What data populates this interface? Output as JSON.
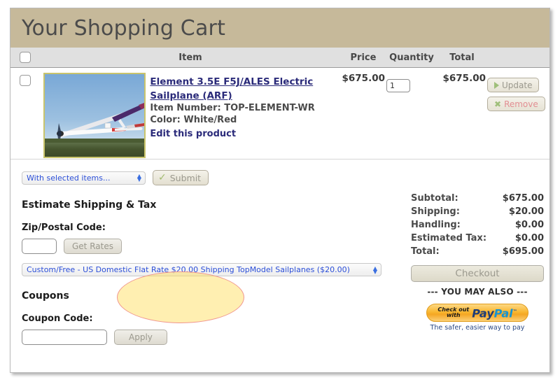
{
  "cart": {
    "title": "Your Shopping Cart",
    "columns": {
      "item": "Item",
      "price": "Price",
      "quantity": "Quantity",
      "total": "Total"
    },
    "rows": [
      {
        "title": "Element 3.5E F5J/ALES Electric Sailplane (ARF)",
        "item_number": "Item Number: TOP-ELEMENT-WR",
        "color": "Color: White/Red",
        "edit_link": "Edit this product",
        "price": "$675.00",
        "quantity": "1",
        "total": "$675.00",
        "update_label": "Update",
        "remove_label": "Remove",
        "image_alt": "sailplane-photo"
      }
    ]
  },
  "actions": {
    "selected_items_select": "With selected items...",
    "submit_label": "Submit"
  },
  "shipping": {
    "heading": "Estimate Shipping & Tax",
    "zip_label": "Zip/Postal Code:",
    "zip_value": "",
    "get_rates_label": "Get Rates",
    "method_select": "Custom/Free - US Domestic Flat Rate $20.00 Shipping TopModel Sailplanes ($20.00)"
  },
  "coupons": {
    "heading": "Coupons",
    "code_label": "Coupon Code:",
    "code_value": "",
    "apply_label": "Apply"
  },
  "summary": {
    "rows": [
      {
        "label": "Subtotal:",
        "value": "$675.00"
      },
      {
        "label": "Shipping:",
        "value": "$20.00"
      },
      {
        "label": "Handling:",
        "value": "$0.00"
      },
      {
        "label": "Estimated Tax:",
        "value": "$0.00"
      },
      {
        "label": "Total:",
        "value": "$695.00"
      }
    ],
    "checkout_label": "Checkout",
    "you_may_also": "--- YOU MAY ALSO ---",
    "paypal": {
      "check_out": "Check out",
      "with": "with",
      "pay": "Pay",
      "pal": "Pal",
      "tagline": "The safer, easier way to pay"
    }
  },
  "colors": {
    "header_bar": "#c6b99a",
    "link": "#2b2b7a",
    "highlight_fill": "#ffdd55",
    "highlight_border": "#f0968e",
    "paypal_orange": "#f9b731"
  }
}
